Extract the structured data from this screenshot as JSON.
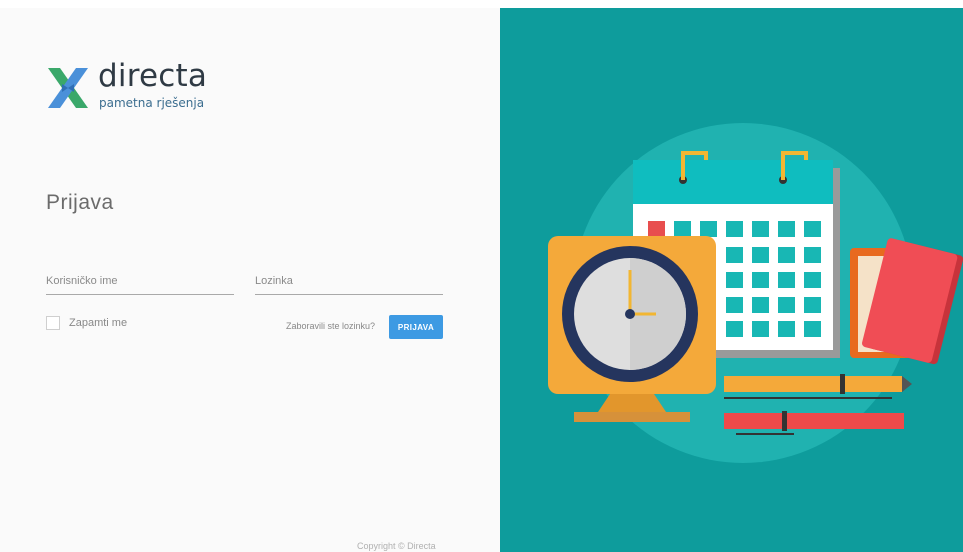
{
  "brand": {
    "name": "directa",
    "tagline": "pametna rješenja",
    "colors": {
      "mark_green": "#3aa86a",
      "mark_blue": "#4a90d9",
      "accent": "#3d9ae3",
      "panel_teal": "#0e9c9c"
    }
  },
  "login": {
    "title": "Prijava",
    "username_placeholder": "Korisničko ime",
    "password_placeholder": "Lozinka",
    "remember_label": "Zapamti me",
    "forgot_link": "Zaboravili ste lozinku?",
    "submit_label": "PRIJAVA"
  },
  "footer": {
    "copyright": "Copyright © Directa"
  },
  "illustration": {
    "icons": [
      "calendar-icon",
      "clock-icon",
      "book-icon",
      "pen-icon"
    ]
  }
}
